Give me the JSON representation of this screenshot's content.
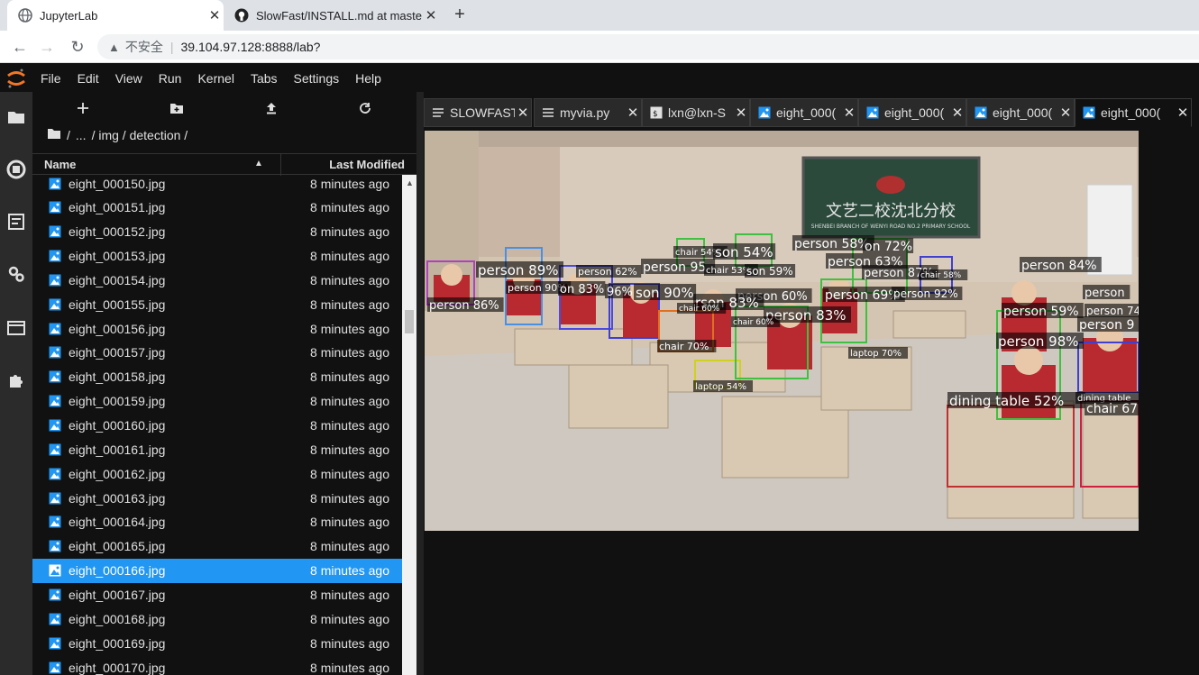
{
  "browser": {
    "tabs": [
      {
        "title": "JupyterLab",
        "icon": "globe-icon"
      },
      {
        "title": "SlowFast/INSTALL.md at maste",
        "icon": "github-icon"
      }
    ],
    "address": {
      "security_label": "不安全",
      "url": "39.104.97.128:8888/lab?"
    }
  },
  "menubar": {
    "items": [
      "File",
      "Edit",
      "View",
      "Run",
      "Kernel",
      "Tabs",
      "Settings",
      "Help"
    ]
  },
  "filebrowser": {
    "breadcrumb": [
      "/",
      "...",
      "/ img / detection /"
    ],
    "columns": {
      "name": "Name",
      "modified": "Last Modified"
    },
    "files": [
      {
        "name": "eight_000150.jpg",
        "modified": "8 minutes ago"
      },
      {
        "name": "eight_000151.jpg",
        "modified": "8 minutes ago"
      },
      {
        "name": "eight_000152.jpg",
        "modified": "8 minutes ago"
      },
      {
        "name": "eight_000153.jpg",
        "modified": "8 minutes ago"
      },
      {
        "name": "eight_000154.jpg",
        "modified": "8 minutes ago"
      },
      {
        "name": "eight_000155.jpg",
        "modified": "8 minutes ago"
      },
      {
        "name": "eight_000156.jpg",
        "modified": "8 minutes ago"
      },
      {
        "name": "eight_000157.jpg",
        "modified": "8 minutes ago"
      },
      {
        "name": "eight_000158.jpg",
        "modified": "8 minutes ago"
      },
      {
        "name": "eight_000159.jpg",
        "modified": "8 minutes ago"
      },
      {
        "name": "eight_000160.jpg",
        "modified": "8 minutes ago"
      },
      {
        "name": "eight_000161.jpg",
        "modified": "8 minutes ago"
      },
      {
        "name": "eight_000162.jpg",
        "modified": "8 minutes ago"
      },
      {
        "name": "eight_000163.jpg",
        "modified": "8 minutes ago"
      },
      {
        "name": "eight_000164.jpg",
        "modified": "8 minutes ago"
      },
      {
        "name": "eight_000165.jpg",
        "modified": "8 minutes ago"
      },
      {
        "name": "eight_000166.jpg",
        "modified": "8 minutes ago",
        "selected": true
      },
      {
        "name": "eight_000167.jpg",
        "modified": "8 minutes ago"
      },
      {
        "name": "eight_000168.jpg",
        "modified": "8 minutes ago"
      },
      {
        "name": "eight_000169.jpg",
        "modified": "8 minutes ago"
      },
      {
        "name": "eight_000170.jpg",
        "modified": "8 minutes ago"
      }
    ]
  },
  "dock": {
    "tabs": [
      {
        "label": "SLOWFAST",
        "icon": "markdown-icon"
      },
      {
        "label": "myvia.py",
        "icon": "file-icon"
      },
      {
        "label": "lxn@lxn-S",
        "icon": "terminal-icon"
      },
      {
        "label": "eight_000(",
        "icon": "image-icon"
      },
      {
        "label": "eight_000(",
        "icon": "image-icon"
      },
      {
        "label": "eight_000(",
        "icon": "image-icon"
      },
      {
        "label": "eight_000(",
        "icon": "image-icon",
        "active": true
      }
    ]
  },
  "image": {
    "board_text": "文艺二校沈北分校",
    "board_subtext": "SHENBEI BRANCH OF WENYI ROAD NO.2 PRIMARY SCHOOL",
    "detections": [
      {
        "label": "person 89%",
        "color": "#4a90e2"
      },
      {
        "label": "person 86%",
        "color": "#b040c0"
      },
      {
        "label": "person 90%",
        "color": "#4a4ae2"
      },
      {
        "label": "on 83%",
        "color": "#4ac04a"
      },
      {
        "label": "96%",
        "color": "#4040d0"
      },
      {
        "label": "person 95",
        "color": "#909090"
      },
      {
        "label": "son 90%",
        "color": "#3a7ad0"
      },
      {
        "label": "chair 54%",
        "color": "#40c040"
      },
      {
        "label": "son 54%",
        "color": "#40c040"
      },
      {
        "label": "chair 53%",
        "color": "#80c040"
      },
      {
        "label": "person 62%",
        "color": "#4ac080"
      },
      {
        "label": "son 59%",
        "color": "#40c0a0"
      },
      {
        "label": "person 58%",
        "color": "#e07020"
      },
      {
        "label": "on 72%",
        "color": "#40c040"
      },
      {
        "label": "person 63%",
        "color": "#40c040"
      },
      {
        "label": "person 87%",
        "color": "#c0c020"
      },
      {
        "label": "chair 58%",
        "color": "#4040d0"
      },
      {
        "label": "person 84%",
        "color": "#c04040"
      },
      {
        "label": "person 60%",
        "color": "#e04040"
      },
      {
        "label": "rson 83%",
        "color": "#404040"
      },
      {
        "label": "chair 60%",
        "color": "#909090"
      },
      {
        "label": "person 69%",
        "color": "#40c040"
      },
      {
        "label": "person 92%",
        "color": "#4060d0"
      },
      {
        "label": "person 59%",
        "color": "#40c040"
      },
      {
        "label": "person 83%",
        "color": "#40c040"
      },
      {
        "label": "person",
        "color": "#e04040"
      },
      {
        "label": "person 74",
        "color": "#4040d0"
      },
      {
        "label": "person 9",
        "color": "#4040d0"
      },
      {
        "label": "chair 60%",
        "color": "#4040d0"
      },
      {
        "label": "person 98%",
        "color": "#40c040"
      },
      {
        "label": "chair 70%",
        "color": "#e07020"
      },
      {
        "label": "laptop 70%",
        "color": "#c04040"
      },
      {
        "label": "laptop 54%",
        "color": "#d0d020"
      },
      {
        "label": "dining table 52%",
        "color": "#c03030"
      },
      {
        "label": "dining table",
        "color": "#6040d0"
      },
      {
        "label": "chair 67",
        "color": "#d02040"
      }
    ]
  }
}
